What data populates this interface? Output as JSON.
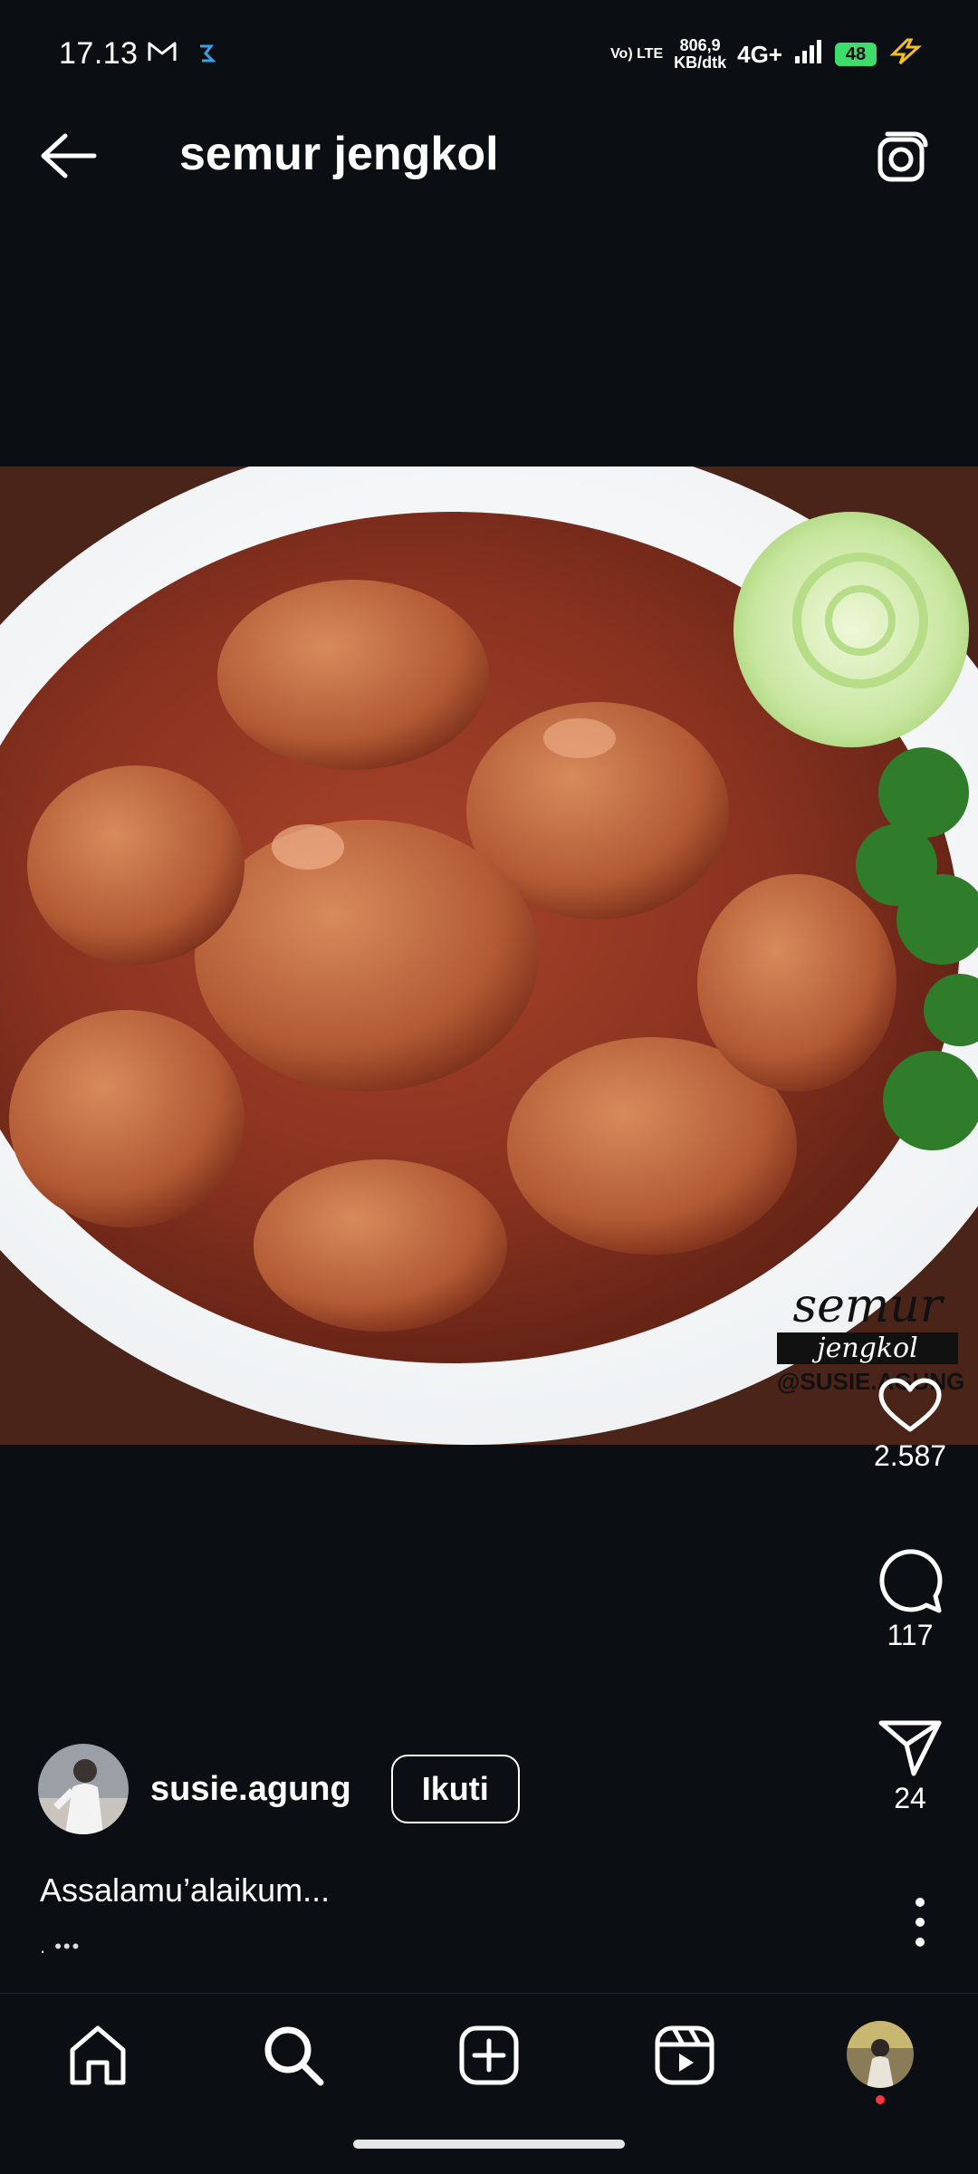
{
  "status_bar": {
    "time": "17.13",
    "network_type": "Vo) LTE",
    "network_speed_value": "806,9",
    "network_speed_unit": "KB/dtk",
    "mobile_data": "4G+",
    "battery_level": "48",
    "icons": [
      "gmail-icon",
      "app-notification-icon",
      "signal-icon",
      "battery-icon",
      "charging-icon"
    ]
  },
  "header": {
    "title": "semur jengkol",
    "back_icon": "arrow-left-icon",
    "camera_icon": "camera-icon"
  },
  "post": {
    "image_description_icon": "food-photo",
    "watermark_lines": [
      "semur",
      "jengkol",
      "@SUSIE.AGUNG"
    ],
    "likes": "2.587",
    "comments": "117",
    "shares": "24",
    "author": {
      "username": "susie.agung",
      "follow_label": "Ikuti"
    },
    "caption": "Assalamu’alaikum...",
    "caption_more": ". •••"
  },
  "bottom_nav": {
    "items": [
      "home-icon",
      "search-icon",
      "create-icon",
      "reels-icon",
      "profile-avatar"
    ]
  },
  "colors": {
    "background": "#0b0f14",
    "text": "#ffffff",
    "battery": "#3ddc6b",
    "notification_dot": "#ff3040"
  }
}
